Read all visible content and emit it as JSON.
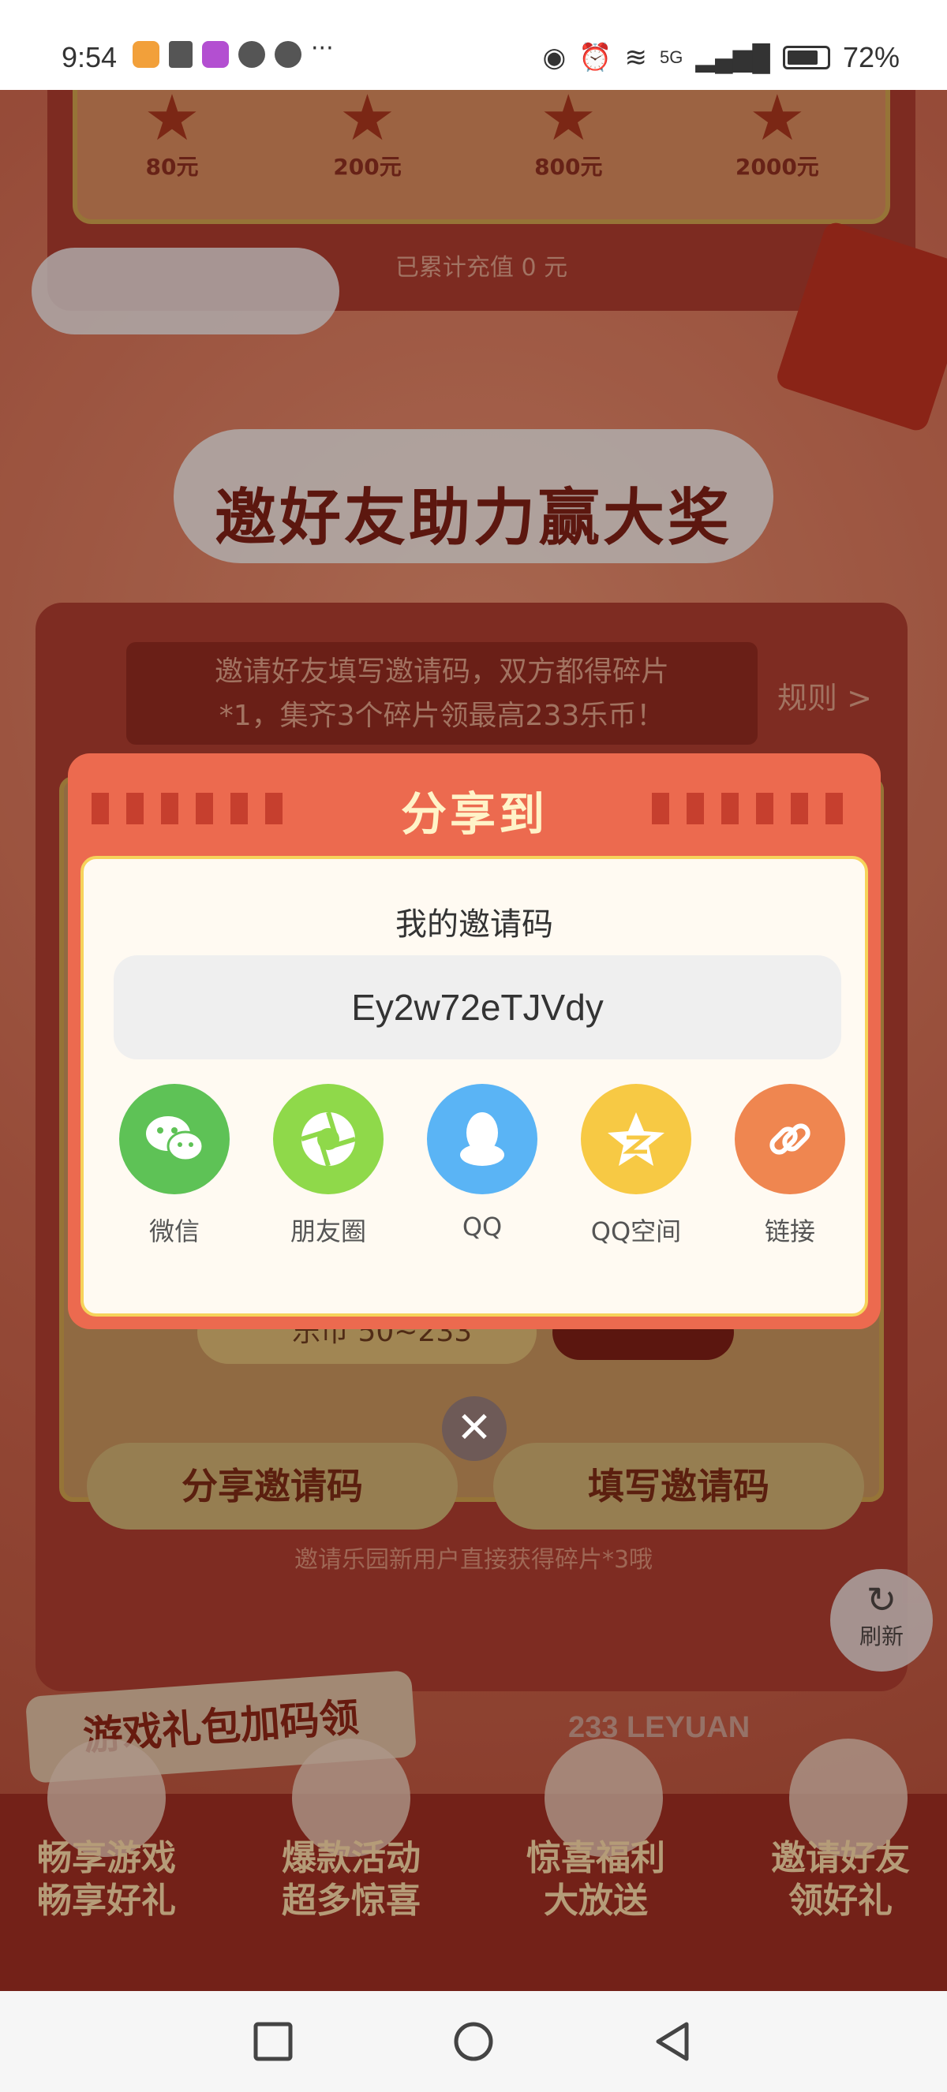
{
  "status_bar": {
    "time": "9:54",
    "signal_text": "5G",
    "battery_percent": "72%",
    "battery_level": 0.72
  },
  "background": {
    "tiers": [
      {
        "amount": "80元"
      },
      {
        "amount": "200元"
      },
      {
        "amount": "800元"
      },
      {
        "amount": "2000元"
      }
    ],
    "accumulated_text": "已累计充值 0 元",
    "event_title": "邀好友助力赢大奖",
    "banner_text_1": "邀请好友填写邀请码，双方都得碎片",
    "banner_text_2": "*1，集齐3个碎片领最高233乐币！",
    "rules_label": "规则 >",
    "coin_text": "乐币 50~233",
    "share_code_button": "分享邀请码",
    "fill_code_button": "填写邀请码",
    "hint_text": "邀请乐园新用户直接获得碎片*3哦",
    "refresh_label": "刷新",
    "gift_tag": "游戏礼包加码领",
    "brand_text": "233 LEYUAN",
    "promos": [
      {
        "line1": "畅享游戏",
        "line2": "畅享好礼"
      },
      {
        "line1": "爆款活动",
        "line2": "超多惊喜"
      },
      {
        "line1": "惊喜福利",
        "line2": "大放送"
      },
      {
        "line1": "邀请好友",
        "line2": "领好礼"
      }
    ]
  },
  "modal": {
    "title": "分享到",
    "code_label": "我的邀请码",
    "invite_code": "Ey2w72eTJVdy",
    "share_targets": [
      {
        "label": "微信",
        "icon": "wechat-icon",
        "color": "#5ec256"
      },
      {
        "label": "朋友圈",
        "icon": "moments-icon",
        "color": "#8fd94a"
      },
      {
        "label": "QQ",
        "icon": "qq-icon",
        "color": "#5ab4f5"
      },
      {
        "label": "QQ空间",
        "icon": "qzone-icon",
        "color": "#f7c944"
      },
      {
        "label": "链接",
        "icon": "link-icon",
        "color": "#ef8650"
      }
    ]
  },
  "colors": {
    "modal_header": "#ec6a4f",
    "modal_border": "#f6d35b",
    "page_background": "#b8553f"
  }
}
